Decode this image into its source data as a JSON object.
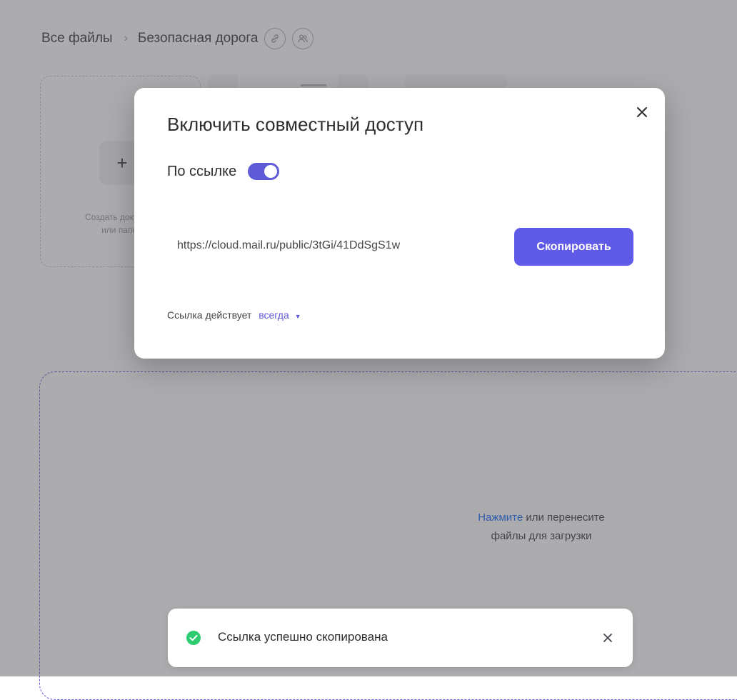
{
  "breadcrumb": {
    "root": "Все файлы",
    "separator": "›",
    "current": "Безопасная дорога"
  },
  "create_card": {
    "plus": "+",
    "line1": "Создать документ",
    "line2": "или папку"
  },
  "dropzone": {
    "link_text": "Нажмите",
    "text_rest": " или перенесите",
    "text_line2": "файлы для загрузки"
  },
  "modal": {
    "title": "Включить совместный доступ",
    "toggle_label": "По ссылке",
    "toggle_on": true,
    "link_url": "https://cloud.mail.ru/public/3tGi/41DdSgS1w",
    "copy_button": "Скопировать",
    "expire_label": "Ссылка действует",
    "expire_value": "всегда"
  },
  "toast": {
    "message": "Ссылка успешно скопирована"
  },
  "colors": {
    "accent": "#605ae8",
    "success": "#2ecc71",
    "link_blue": "#005ff9"
  },
  "icons": {
    "share_link": "link-icon",
    "share_users": "users-icon",
    "close": "close-icon",
    "success": "check-circle-icon",
    "caret": "caret-down-icon"
  }
}
